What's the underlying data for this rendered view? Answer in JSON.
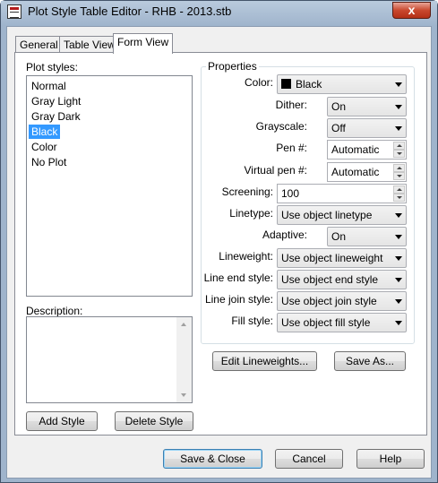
{
  "window": {
    "title": "Plot Style Table Editor - RHB - 2013.stb",
    "close_glyph": "x"
  },
  "tabs": [
    {
      "label": "General"
    },
    {
      "label": "Table View"
    },
    {
      "label": "Form View",
      "active": true
    }
  ],
  "plot_styles": {
    "label": "Plot styles:",
    "items": [
      "Normal",
      "Gray Light",
      "Gray Dark",
      "Black",
      "Color",
      "No Plot"
    ],
    "selected": "Black"
  },
  "description": {
    "label": "Description:",
    "value": ""
  },
  "left_buttons": {
    "add_style": "Add Style",
    "delete_style": "Delete Style"
  },
  "properties": {
    "title": "Properties",
    "color_label": "Color:",
    "color_value": "Black",
    "color_swatch": "#000000",
    "dither_label": "Dither:",
    "dither_value": "On",
    "grayscale_label": "Grayscale:",
    "grayscale_value": "Off",
    "pen_label": "Pen #:",
    "pen_value": "Automatic",
    "virtual_pen_label": "Virtual pen #:",
    "virtual_pen_value": "Automatic",
    "screening_label": "Screening:",
    "screening_value": "100",
    "linetype_label": "Linetype:",
    "linetype_value": "Use object linetype",
    "adaptive_label": "Adaptive:",
    "adaptive_value": "On",
    "lineweight_label": "Lineweight:",
    "lineweight_value": "Use object lineweight",
    "line_end_label": "Line end style:",
    "line_end_value": "Use object end style",
    "line_join_label": "Line join style:",
    "line_join_value": "Use object join style",
    "fill_label": "Fill style:",
    "fill_value": "Use object fill style"
  },
  "property_buttons": {
    "edit_lineweights": "Edit Lineweights...",
    "save_as": "Save As..."
  },
  "footer": {
    "save_close": "Save & Close",
    "cancel": "Cancel",
    "help": "Help"
  }
}
